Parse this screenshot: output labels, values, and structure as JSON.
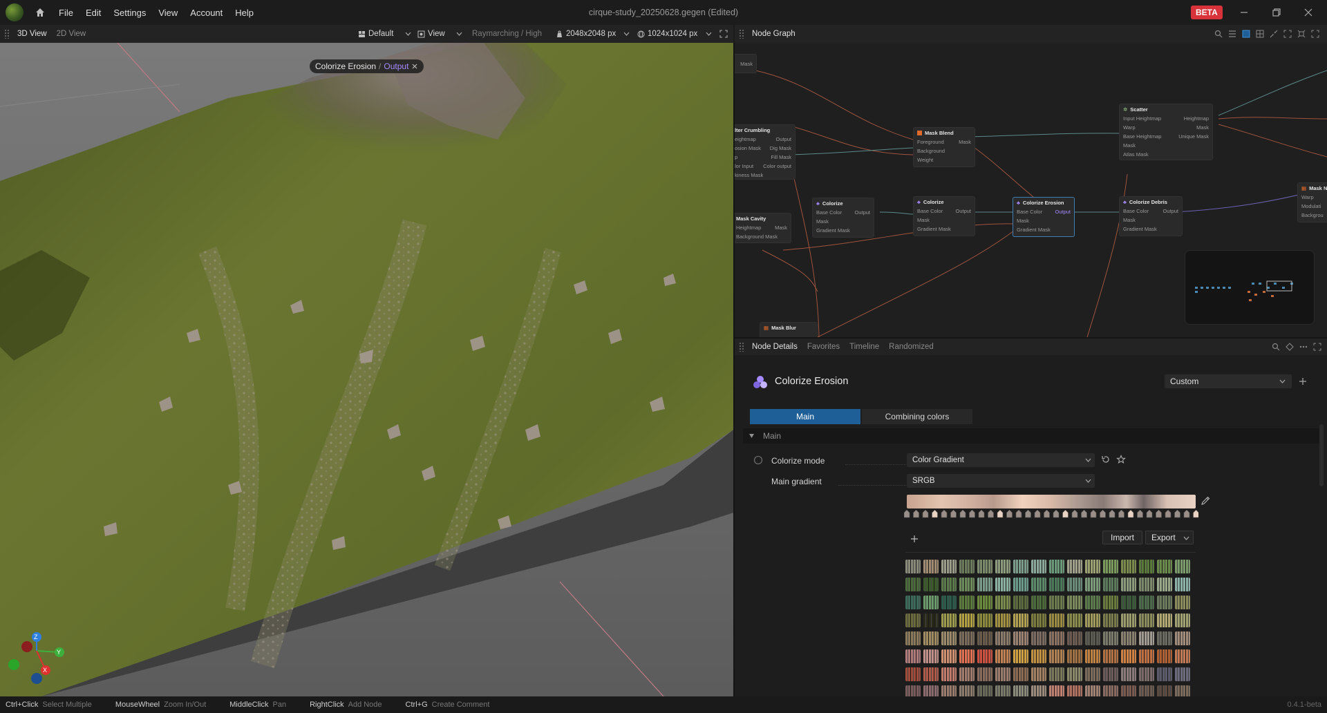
{
  "app": {
    "menu": [
      "File",
      "Edit",
      "Settings",
      "View",
      "Account",
      "Help"
    ],
    "document_title": "cirque-study_20250628.gegen",
    "document_state": "(Edited)",
    "beta_badge": "BETA"
  },
  "left_toolbar": {
    "tabs": [
      "3D View",
      "2D View"
    ],
    "preset": "Default",
    "view_menu": "View",
    "render_mode": "Raymarching / High",
    "resolution": "2048x2048 px",
    "texture_size": "1024x1024 px"
  },
  "viewport": {
    "chip_node": "Colorize Erosion",
    "chip_separator": "/",
    "chip_port": "Output",
    "gizmo": {
      "z": "Z",
      "y": "Y",
      "x": "X"
    }
  },
  "node_graph": {
    "tab": "Node Graph",
    "nodes": [
      {
        "title": "",
        "rows": [
          [
            "",
            "Mask"
          ]
        ]
      },
      {
        "title": "lter Crumbling",
        "rows": [
          [
            "eightmap",
            "Output"
          ],
          [
            "osion Mask",
            "Dig Mask"
          ],
          [
            "p",
            "Fill Mask"
          ],
          [
            "lor Input",
            "Color output"
          ],
          [
            "kiness Mask",
            ""
          ]
        ]
      },
      {
        "title": "Mask Blend",
        "rows": [
          [
            "Foreground",
            "Mask"
          ],
          [
            "Background",
            ""
          ],
          [
            "Weight",
            ""
          ]
        ]
      },
      {
        "title": "Scatter",
        "rows": [
          [
            "Input Heightmap",
            "Heightmap"
          ],
          [
            "Warp",
            "Mask"
          ],
          [
            "Base Heightmap",
            "Unique Mask"
          ],
          [
            "Mask",
            ""
          ],
          [
            "Atlas Mask",
            ""
          ]
        ]
      },
      {
        "title": "Mask Cavity",
        "rows": [
          [
            "Heightmap",
            "Mask"
          ],
          [
            "Background Mask",
            ""
          ]
        ]
      },
      {
        "title": "Colorize",
        "rows": [
          [
            "Base Color",
            "Output"
          ],
          [
            "Mask",
            ""
          ],
          [
            "Gradient Mask",
            ""
          ]
        ]
      },
      {
        "title": "Colorize",
        "rows": [
          [
            "Base Color",
            "Output"
          ],
          [
            "Mask",
            ""
          ],
          [
            "Gradient Mask",
            ""
          ]
        ]
      },
      {
        "title": "Colorize Erosion",
        "rows": [
          [
            "Base Color",
            "Output"
          ],
          [
            "Mask",
            ""
          ],
          [
            "Gradient Mask",
            ""
          ]
        ]
      },
      {
        "title": "Colorize Debris",
        "rows": [
          [
            "Base Color",
            "Output"
          ],
          [
            "Mask",
            ""
          ],
          [
            "Gradient Mask",
            ""
          ]
        ]
      },
      {
        "title": "Mask N",
        "rows": [
          [
            "Warp",
            ""
          ],
          [
            "Modulati",
            ""
          ],
          [
            "Backgrou",
            ""
          ]
        ]
      },
      {
        "title": "Mask Blur",
        "rows": []
      }
    ]
  },
  "details": {
    "tabs": [
      "Node Details",
      "Favorites",
      "Timeline",
      "Randomized"
    ],
    "node_title": "Colorize Erosion",
    "preset_value": "Custom",
    "subtabs": [
      "Main",
      "Combining colors"
    ],
    "section": "Main",
    "colorize_mode_label": "Colorize mode",
    "colorize_mode_value": "Color Gradient",
    "main_gradient_label": "Main gradient",
    "gradient_space": "SRGB",
    "import_label": "Import",
    "export_label": "Export",
    "plus": "+"
  },
  "statusbar": {
    "hints": [
      {
        "key": "Ctrl+Click",
        "action": "Select Multiple"
      },
      {
        "key": "MouseWheel",
        "action": "Zoom In/Out"
      },
      {
        "key": "MiddleClick",
        "action": "Pan"
      },
      {
        "key": "RightClick",
        "action": "Add Node"
      },
      {
        "key": "Ctrl+G",
        "action": "Create Comment"
      }
    ],
    "version": "0.4.1-beta"
  },
  "colors": {
    "accent": "#a58bff",
    "selected_tab": "#1f5f97",
    "beta": "#d8333a",
    "terrain_green": "#5f6b2a",
    "rock": "#9b8f8f"
  }
}
